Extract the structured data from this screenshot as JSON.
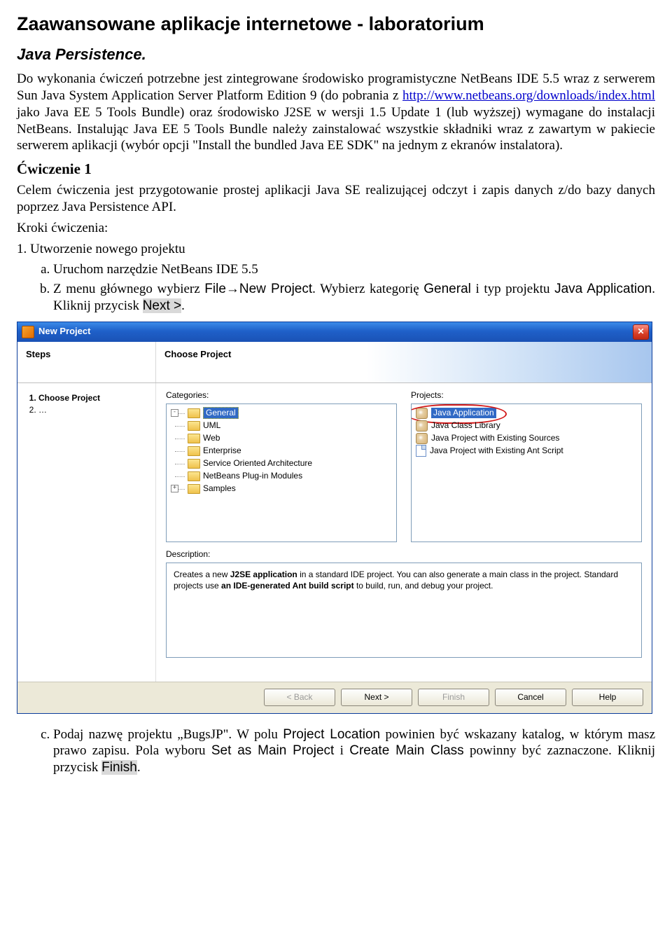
{
  "doc": {
    "title": "Zaawansowane aplikacje internetowe - laboratorium",
    "subtitle": "Java Persistence.",
    "intro_part1": "Do wykonania ćwiczeń potrzebne jest zintegrowane środowisko programistyczne NetBeans IDE 5.5 wraz z serwerem Sun Java System Application Server Platform Edition 9 (do pobrania z ",
    "intro_link": "http://www.netbeans.org/downloads/index.html",
    "intro_part2": " jako Java EE 5 Tools Bundle) oraz środowisko J2SE w wersji 1.5 Update 1 (lub wyższej) wymagane do instalacji NetBeans. Instalując Java EE 5 Tools Bundle należy zainstalować wszystkie składniki wraz z zawartym w pakiecie serwerem aplikacji (wybór opcji \"Install the bundled Java EE SDK\" na jednym z ekranów instalatora).",
    "exercise_heading": "Ćwiczenie 1",
    "exercise_desc": "Celem ćwiczenia jest przygotowanie prostej aplikacji Java SE realizującej odczyt i zapis danych z/do bazy danych poprzez Java Persistence API.",
    "steps_label": "Kroki ćwiczenia:",
    "step1": "1. Utworzenie nowego projektu",
    "step1a": "Uruchom narzędzie NetBeans IDE 5.5",
    "step1b_pre": "Z menu głównego wybierz ",
    "step1b_file": "File→New Project",
    "step1b_mid": ". Wybierz kategorię ",
    "step1b_general": "General",
    "step1b_mid2": " i typ projektu ",
    "step1b_javaapp": "Java Application",
    "step1b_end": ". Kliknij przycisk ",
    "step1b_next": "Next >",
    "step1b_period": ".",
    "step1c_pre": "Podaj nazwę projektu „BugsJP\". W polu ",
    "step1c_projloc": "Project Location",
    "step1c_mid": " powinien być wskazany katalog, w którym masz prawo zapisu. Pola wyboru ",
    "step1c_setmain": "Set as Main Project",
    "step1c_and": " i ",
    "step1c_createmain": "Create Main Class",
    "step1c_mid2": " powinny być zaznaczone. Kliknij przycisk ",
    "step1c_finish": "Finish",
    "step1c_period": "."
  },
  "dialog": {
    "title": "New Project",
    "steps_label": "Steps",
    "choose_label": "Choose Project",
    "steps": [
      {
        "n": "1.",
        "label": "Choose Project",
        "bold": true
      },
      {
        "n": "2.",
        "label": "…",
        "bold": false
      }
    ],
    "categories_label": "Categories:",
    "projects_label": "Projects:",
    "categories": [
      {
        "label": "General",
        "selected": true,
        "expand": "-"
      },
      {
        "label": "UML",
        "selected": false,
        "expand": ""
      },
      {
        "label": "Web",
        "selected": false,
        "expand": ""
      },
      {
        "label": "Enterprise",
        "selected": false,
        "expand": ""
      },
      {
        "label": "Service Oriented Architecture",
        "selected": false,
        "expand": ""
      },
      {
        "label": "NetBeans Plug-in Modules",
        "selected": false,
        "expand": ""
      },
      {
        "label": "Samples",
        "selected": false,
        "expand": "+"
      }
    ],
    "projects": [
      {
        "label": "Java Application",
        "icon": "java",
        "selected": true,
        "circled": true
      },
      {
        "label": "Java Class Library",
        "icon": "java",
        "selected": false,
        "circled": false
      },
      {
        "label": "Java Project with Existing Sources",
        "icon": "java",
        "selected": false,
        "circled": false
      },
      {
        "label": "Java Project with Existing Ant Script",
        "icon": "script",
        "selected": false,
        "circled": false
      }
    ],
    "description_label": "Description:",
    "description_html": "Creates a new <b>J2SE application</b> in a standard IDE project. You can also generate a main class in the project. Standard projects use <b>an IDE-generated Ant build script</b> to build, run, and debug your project.",
    "buttons": {
      "back": "< Back",
      "next": "Next >",
      "finish": "Finish",
      "cancel": "Cancel",
      "help": "Help"
    }
  }
}
